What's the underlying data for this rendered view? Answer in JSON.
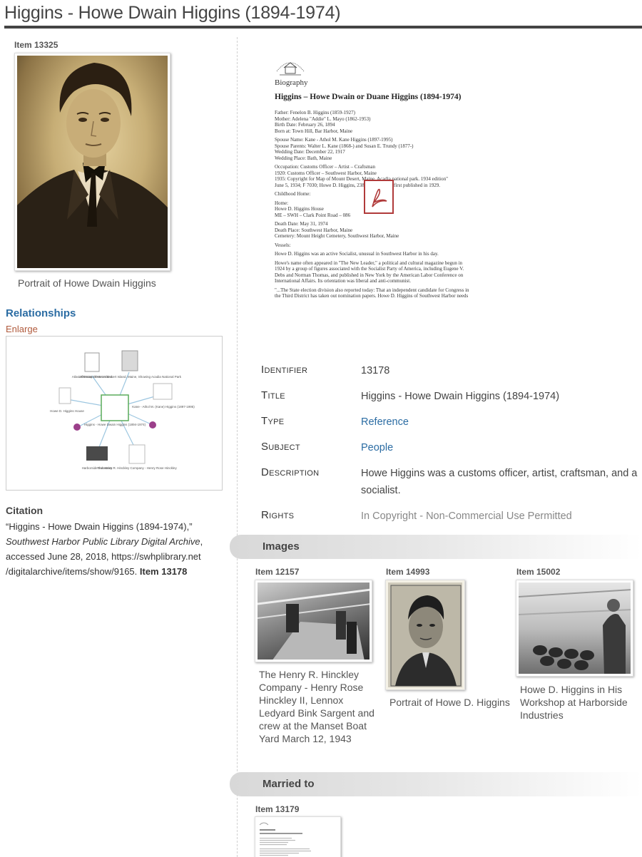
{
  "page": {
    "title": "Higgins - Howe Dwain Higgins (1894-1974)"
  },
  "main_item": {
    "item_label": "Item 13325",
    "caption": "Portrait of Howe Dwain Higgins"
  },
  "relationships": {
    "heading": "Relationships",
    "enlarge": "Enlarge",
    "nodes": {
      "top_left": "Atlas of Mount Desert Island",
      "top_right": "1935 Map of Mount Desert Island, Maine, Showing Acadia National Park",
      "left": "Howe D. Higgins House",
      "right": "Kane - Athol M. (Kane) Higgins (1897-1995)",
      "center": "Higgins - Howe Dwain Higgins (1894-1974)",
      "bottom_left": "Harborside Industries",
      "bottom_right": "The Henry R. Hinckley Company - Henry Rose Hinckley"
    }
  },
  "citation": {
    "heading": "Citation",
    "part1": "“Higgins - Howe Dwain Higgins (1894-1974),”",
    "part2": "Southwest Harbor Public Library Digital Archive",
    "part3": ", accessed June 28, 2018, https://swhplibrary.net /digitalarchive/items/show/9165.",
    "part4": "Item 13178"
  },
  "document": {
    "heading": "Biography",
    "title": "Higgins – Howe Dwain or Duane Higgins (1894-1974)",
    "lines": [
      "Father: Fenelon B. Higgins (1859-1927)",
      "Mother: Adelena \"Addie\" L. Mayo (1862-1953)",
      "Birth Date: February 26, 1894",
      "Born at: Town Hill, Bar Harbor, Maine",
      "",
      "Spouse Name: Kane - Athol M. Kane Higgins (1897-1995)",
      "Spouse Parents: Walter L. Kane (1868-) and Susan E. Trundy (1877-)",
      "Wedding Date: December 22, 1917",
      "Wedding Place: Bath, Maine",
      "",
      "Occupation: Customs Officer – Artist – Craftsman",
      "1920: Customs Officer – Southwest Harbor, Maine",
      "1935: Copyright for Map of Mount Desert, Maine. Acadia national park. 1934 edition\"",
      "June 5, 1934; F 7030; Howe D. Higgins, 2384 ... published first published in 1929.",
      "",
      "Childhood Home:",
      "",
      "Home:",
      "Howe D. Higgins House",
      "ME – SWH – Clark Point Road – 086",
      "",
      "Death Date: May 31, 1974",
      "Death Place: Southwest Harbor, Maine",
      "Cemetery: Mount Height Cemetery, Southwest Harbor, Maine",
      "",
      "Vessels:",
      "",
      "Howe D. Higgins was an active Socialist, unusual in Southwest Harbor in his day.",
      "",
      "Howe's name often appeared in \"The New Leader,\" a political and cultural magazine begun in",
      "1924 by a group of figures associated with the Socialist Party of America, including Eugene V.",
      "Debs and Norman Thomas, and published in New York by the American Labor Conference on",
      "International Affairs. Its orientation was liberal and anti-communist.",
      "",
      "\"...The State election division also reported today: That an independent candidate for Congress in",
      "the Third District has taken out nomination papers. Howe D. Higgins of Southwest Harbor needs"
    ]
  },
  "metadata": {
    "identifier_label": "Identifier",
    "identifier_value": "13178",
    "title_label": "Title",
    "title_value": "Higgins - Howe Dwain Higgins (1894-1974)",
    "type_label": "Type",
    "type_value": "Reference",
    "subject_label": "Subject",
    "subject_value": "People",
    "description_label": "Description",
    "description_value": "Howe Higgins was a customs officer, artist, craftsman, and a socialist.",
    "rights_label": "Rights",
    "rights_value": "In Copyright - Non-Commercial Use Permitted"
  },
  "images_section": {
    "heading": "Images",
    "items": [
      {
        "item_label": "Item 12157",
        "caption": "The Henry R. Hinckley Company - Henry Rose Hinckley II, Lennox Ledyard Bink Sargent and crew at the Manset Boat Yard March 12, 1943"
      },
      {
        "item_label": "Item 14993",
        "caption": "Portrait of Howe D. Higgins"
      },
      {
        "item_label": "Item 15002",
        "caption": "Howe D. Higgins in His Workshop at Harborside Industries"
      }
    ]
  },
  "married_section": {
    "heading": "Married to",
    "item_label": "Item 13179"
  },
  "colors": {
    "link": "#2b6ca3",
    "enlarge": "#b05a3c",
    "pdf_icon": "#b03a3a",
    "graph_node_purple": "#9b3f8a"
  }
}
